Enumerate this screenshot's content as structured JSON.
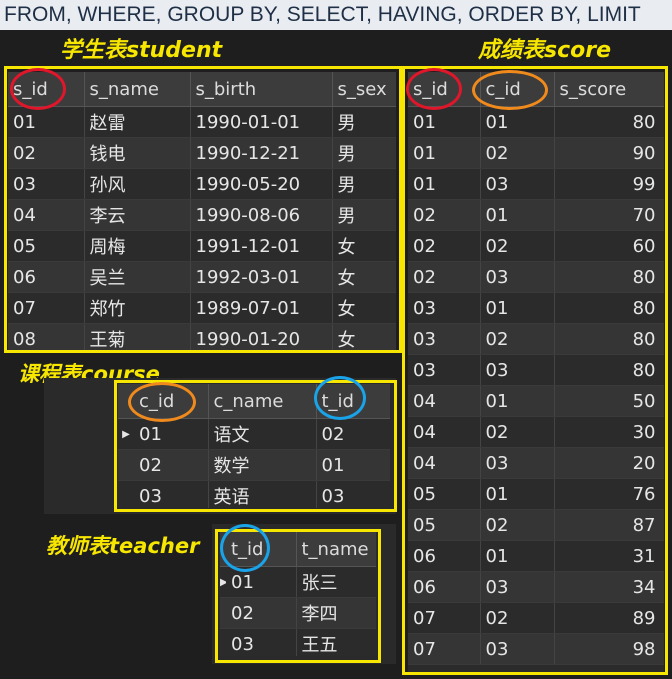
{
  "banner": "FROM, WHERE, GROUP BY, SELECT, HAVING, ORDER BY, LIMIT",
  "headings": {
    "student": "学生表student",
    "score": "成绩表score",
    "course": "课程表course",
    "teacher": "教师表teacher"
  },
  "student": {
    "columns": [
      "s_id",
      "s_name",
      "s_birth",
      "s_sex"
    ],
    "rows": [
      [
        "01",
        "赵雷",
        "1990-01-01",
        "男"
      ],
      [
        "02",
        "钱电",
        "1990-12-21",
        "男"
      ],
      [
        "03",
        "孙风",
        "1990-05-20",
        "男"
      ],
      [
        "04",
        "李云",
        "1990-08-06",
        "男"
      ],
      [
        "05",
        "周梅",
        "1991-12-01",
        "女"
      ],
      [
        "06",
        "吴兰",
        "1992-03-01",
        "女"
      ],
      [
        "07",
        "郑竹",
        "1989-07-01",
        "女"
      ],
      [
        "08",
        "王菊",
        "1990-01-20",
        "女"
      ]
    ]
  },
  "score": {
    "columns": [
      "s_id",
      "c_id",
      "s_score"
    ],
    "rows": [
      [
        "01",
        "01",
        "80"
      ],
      [
        "01",
        "02",
        "90"
      ],
      [
        "01",
        "03",
        "99"
      ],
      [
        "02",
        "01",
        "70"
      ],
      [
        "02",
        "02",
        "60"
      ],
      [
        "02",
        "03",
        "80"
      ],
      [
        "03",
        "01",
        "80"
      ],
      [
        "03",
        "02",
        "80"
      ],
      [
        "03",
        "03",
        "80"
      ],
      [
        "04",
        "01",
        "50"
      ],
      [
        "04",
        "02",
        "30"
      ],
      [
        "04",
        "03",
        "20"
      ],
      [
        "05",
        "01",
        "76"
      ],
      [
        "05",
        "02",
        "87"
      ],
      [
        "06",
        "01",
        "31"
      ],
      [
        "06",
        "03",
        "34"
      ],
      [
        "07",
        "02",
        "89"
      ],
      [
        "07",
        "03",
        "98"
      ]
    ]
  },
  "course": {
    "columns": [
      "c_id",
      "c_name",
      "t_id"
    ],
    "rows": [
      [
        "01",
        "语文",
        "02"
      ],
      [
        "02",
        "数学",
        "01"
      ],
      [
        "03",
        "英语",
        "03"
      ]
    ]
  },
  "teacher": {
    "columns": [
      "t_id",
      "t_name"
    ],
    "rows": [
      [
        "01",
        "张三"
      ],
      [
        "02",
        "李四"
      ],
      [
        "03",
        "王五"
      ]
    ]
  },
  "colors": {
    "highlight_box": "#f7e600",
    "ring_student_key": "#e0162b",
    "ring_course_key": "#f08a1c",
    "ring_teacher_key": "#1aa3e8"
  }
}
